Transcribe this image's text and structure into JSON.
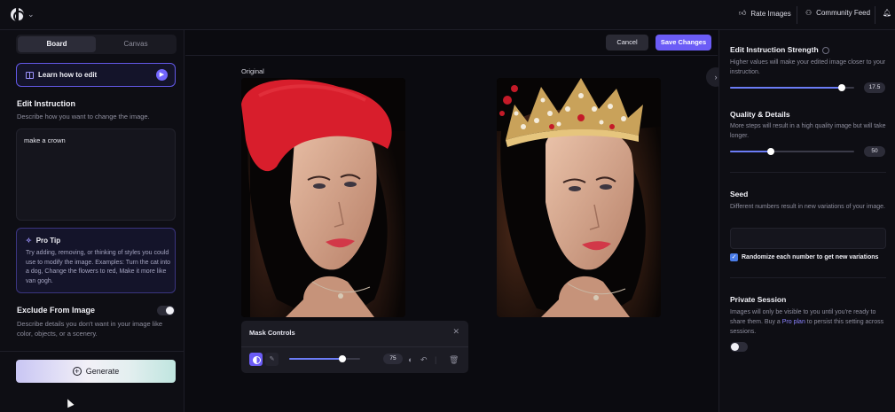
{
  "topbar": {
    "rate_images": "Rate Images",
    "community_feed": "Community Feed"
  },
  "left": {
    "tabs": [
      {
        "label": "Board",
        "active": true
      },
      {
        "label": "Canvas",
        "active": false
      }
    ],
    "learn_label": "Learn how to edit",
    "edit_instruction_title": "Edit Instruction",
    "edit_instruction_desc": "Describe how you want to change the image.",
    "instruction_value": "make a crown",
    "protip_title": "Pro Tip",
    "protip_text": "Try adding, removing, or thinking of styles you could use to modify the image. Examples: Turn the cat into a dog, Change the flowers to red, Make it more like van gogh.",
    "exclude_title": "Exclude From Image",
    "exclude_desc": "Describe details you don't want in your image like color, objects, or a scenery.",
    "exclude_enabled": true,
    "generate_label": "Generate"
  },
  "center": {
    "cancel_label": "Cancel",
    "save_label": "Save Changes",
    "original_label": "Original",
    "mask_controls_title": "Mask Controls",
    "brush_size": "75",
    "brush_size_fraction": 0.75
  },
  "right": {
    "strength_title": "Edit Instruction Strength",
    "strength_desc": "Higher values will make your edited image closer to your instruction.",
    "strength_value": "17.5",
    "strength_fraction": 0.9,
    "quality_title": "Quality & Details",
    "quality_desc": "More steps will result in a high quality image but will take longer.",
    "quality_value": "50",
    "quality_fraction": 0.33,
    "seed_title": "Seed",
    "seed_desc": "Different numbers result in new variations of your image.",
    "seed_value": "",
    "randomize_label": "Randomize each number to get new variations",
    "randomize_checked": true,
    "private_title": "Private Session",
    "private_desc_1": "Images will only be visible to you until you're ready to share them. Buy a ",
    "private_link": "Pro plan",
    "private_desc_2": " to persist this setting across sessions.",
    "private_enabled": false
  },
  "colors": {
    "accent": "#6b5cf6",
    "mask_red": "#d81e2c",
    "background": "#0b0b10"
  }
}
